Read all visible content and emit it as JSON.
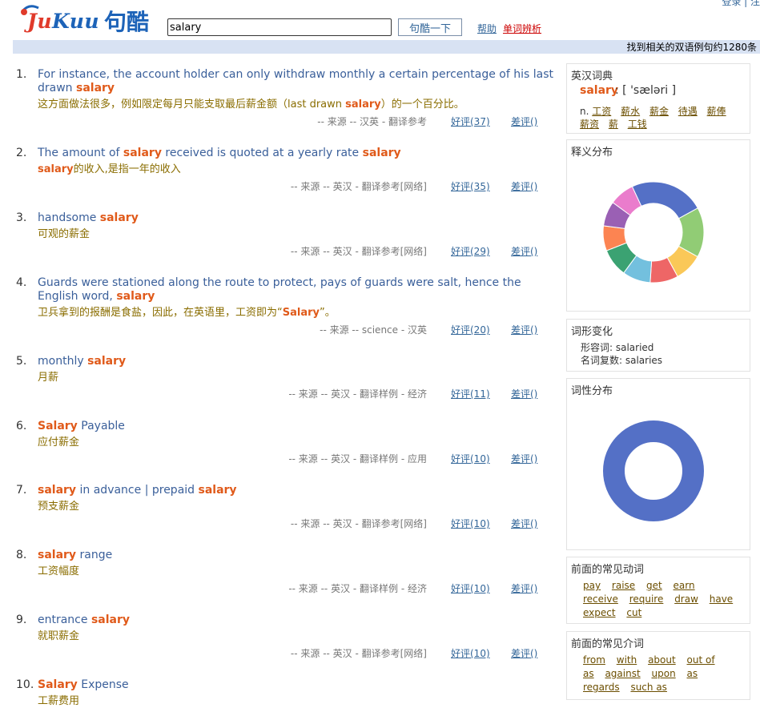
{
  "top": {
    "login_text": "登录 | 注"
  },
  "logo": {
    "latin_prefix": "Ju",
    "latin_suffix": "Kuu",
    "cjk": "句酷"
  },
  "search": {
    "value": "salary",
    "button": "句酷一下",
    "help": "帮助",
    "analysis": "单词辨析"
  },
  "result_count": "找到相关的双语例句约1280条",
  "results": [
    {
      "num": "1.",
      "en": [
        "For instance, the account holder can only withdraw monthly a certain percentage of his last drawn ",
        {
          "b": "salary"
        }
      ],
      "cn": [
        "这方面做法很多，例如限定每月只能支取最后薪金额（last drawn ",
        {
          "b": "salary"
        },
        "）的一个百分比。"
      ],
      "src": "-- 来源 -- 汉英 - 翻译参考",
      "good": "好评(37)",
      "bad": "差评()"
    },
    {
      "num": "2.",
      "en": [
        "The amount of ",
        {
          "b": "salary"
        },
        " received is quoted at a yearly rate ",
        {
          "b": "salary"
        }
      ],
      "cn": [
        {
          "b": "salary"
        },
        "的收入,是指一年的收入"
      ],
      "src": "-- 来源 -- 英汉 - 翻译参考[网络]",
      "good": "好评(35)",
      "bad": "差评()"
    },
    {
      "num": "3.",
      "en": [
        "handsome ",
        {
          "b": "salary"
        }
      ],
      "cn": [
        "可观的薪金"
      ],
      "src": "-- 来源 -- 英汉 - 翻译参考[网络]",
      "good": "好评(29)",
      "bad": "差评()"
    },
    {
      "num": "4.",
      "en": [
        "Guards were stationed along the route to protect, pays of guards were salt, hence the English word, ",
        {
          "b": "salary"
        }
      ],
      "cn": [
        "卫兵拿到的报酬是食盐，因此，在英语里，工资即为“",
        {
          "b": "Salary"
        },
        "”。"
      ],
      "src": "-- 来源 -- science - 汉英",
      "good": "好评(20)",
      "bad": "差评()"
    },
    {
      "num": "5.",
      "en": [
        "monthly ",
        {
          "b": "salary"
        }
      ],
      "cn": [
        "月薪"
      ],
      "src": "-- 来源 -- 英汉 - 翻译样例 - 经济",
      "good": "好评(11)",
      "bad": "差评()"
    },
    {
      "num": "6.",
      "en": [
        {
          "b": "Salary"
        },
        " Payable"
      ],
      "cn": [
        "应付薪金"
      ],
      "src": "-- 来源 -- 英汉 - 翻译样例 - 应用",
      "good": "好评(10)",
      "bad": "差评()"
    },
    {
      "num": "7.",
      "en": [
        {
          "b": "salary"
        },
        " in advance | prepaid ",
        {
          "b": "salary"
        }
      ],
      "cn": [
        "预支薪金"
      ],
      "src": "-- 来源 -- 英汉 - 翻译参考[网络]",
      "good": "好评(10)",
      "bad": "差评()"
    },
    {
      "num": "8.",
      "en": [
        {
          "b": "salary"
        },
        " range"
      ],
      "cn": [
        "工资幅度"
      ],
      "src": "-- 来源 -- 英汉 - 翻译样例 - 经济",
      "good": "好评(10)",
      "bad": "差评()"
    },
    {
      "num": "9.",
      "en": [
        "entrance ",
        {
          "b": "salary"
        }
      ],
      "cn": [
        "就职薪金"
      ],
      "src": "-- 来源 -- 英汉 - 翻译参考[网络]",
      "good": "好评(10)",
      "bad": "差评()"
    },
    {
      "num": "10.",
      "en": [
        {
          "b": "Salary"
        },
        " Expense"
      ],
      "cn": [
        "工薪费用"
      ],
      "src": "",
      "good": "",
      "bad": ""
    }
  ],
  "sidebar": {
    "dict": {
      "title": "英汉词典",
      "word": "salary",
      "phonetic": ": [ 'sæləri ]",
      "pos": "n.",
      "defs": [
        "工资",
        "薪水",
        "薪金",
        "待遇",
        "薪俸",
        "薪资",
        "薪",
        "工钱"
      ]
    },
    "sense_dist": {
      "title": "释义分布",
      "colors": [
        "#5470c6",
        "#91cc75",
        "#fac858",
        "#ee6666",
        "#73c0de",
        "#3ba272",
        "#fc8452",
        "#9a60b4",
        "#ea7ccc"
      ],
      "values": [
        24,
        16,
        9,
        9,
        9,
        9,
        8,
        8,
        8
      ]
    },
    "morph": {
      "title": "词形变化",
      "adj": "形容词: salaried",
      "plural": "名词复数: salaries"
    },
    "pos_dist": {
      "title": "词性分布",
      "colors": [
        "#5470c6"
      ],
      "values": [
        100
      ]
    },
    "verbs": {
      "title": "前面的常见动词",
      "items": [
        "pay",
        "raise",
        "get",
        "earn",
        "receive",
        "require",
        "draw",
        "have",
        "expect",
        "cut"
      ]
    },
    "preps": {
      "title": "前面的常见介词",
      "items": [
        "from",
        "with",
        "about",
        "out of",
        "as",
        "against",
        "upon",
        "as",
        "regards",
        "such as"
      ]
    }
  }
}
